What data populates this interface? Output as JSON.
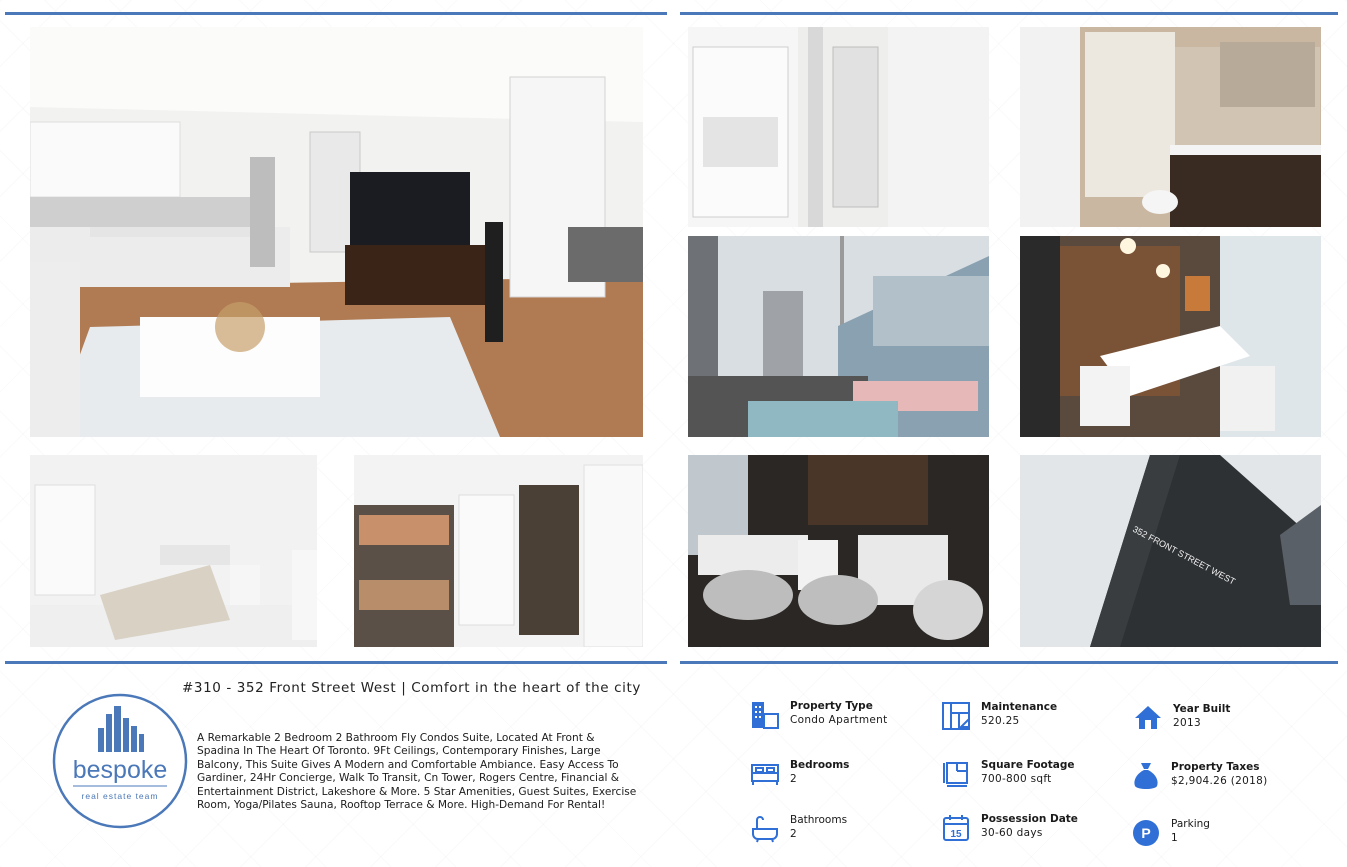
{
  "listing": {
    "headline": "#310 - 352 Front Street West | Comfort in the heart of the city",
    "description": "A Remarkable 2 Bedroom 2 Bathroom Fly Condos Suite, Located At Front & Spadina In The Heart Of Toronto. 9Ft Ceilings, Contemporary Finishes, Large Balcony, This Suite Gives A Modern and Comfortable Ambiance. Easy Access To Gardiner, 24Hr Concierge, Walk To Transit, Cn Tower, Rogers Centre, Financial & Entertainment District, Lakeshore & More. 5 Star Amenities, Guest Suites, Exercise Room, Yoga/Pilates Sauna, Rooftop Terrace & More. High-Demand For Rental!"
  },
  "logo": {
    "name": "bespoke",
    "tagline": "real estate team"
  },
  "photos": [
    {
      "name": "living-room-photo"
    },
    {
      "name": "laundry-photo"
    },
    {
      "name": "bathroom-photo"
    },
    {
      "name": "rooftop-terrace-photo"
    },
    {
      "name": "party-room-photo"
    },
    {
      "name": "bedroom-photo"
    },
    {
      "name": "den-photo"
    },
    {
      "name": "lounge-photo"
    },
    {
      "name": "building-exterior-photo",
      "sign_text": "352 FRONT STREET WEST"
    }
  ],
  "facts": {
    "property_type": {
      "label": "Property Type",
      "value": "Condo Apartment",
      "icon": "building-icon"
    },
    "maintenance": {
      "label": "Maintenance",
      "value": "520.25",
      "icon": "blueprint-icon"
    },
    "year_built": {
      "label": "Year Built",
      "value": "2013",
      "icon": "house-icon"
    },
    "bedrooms": {
      "label": "Bedrooms",
      "value": "2",
      "icon": "bed-icon"
    },
    "square_footage": {
      "label": "Square Footage",
      "value": "700-800 sqft",
      "icon": "floorplan-icon"
    },
    "property_taxes": {
      "label": "Property Taxes",
      "value": "$2,904.26 (2018)",
      "icon": "money-bag-icon"
    },
    "bathrooms": {
      "label": "Bathrooms",
      "value": "2",
      "icon": "bathtub-icon"
    },
    "possession_date": {
      "label": "Possession Date",
      "value": "30-60 days",
      "icon": "calendar-icon",
      "calendar_day": "15"
    },
    "parking": {
      "label": "Parking",
      "value": "1",
      "icon": "parking-icon",
      "icon_letter": "P"
    }
  },
  "colors": {
    "accent": "#4b78b8",
    "icon_blue": "#2f6fd6"
  }
}
